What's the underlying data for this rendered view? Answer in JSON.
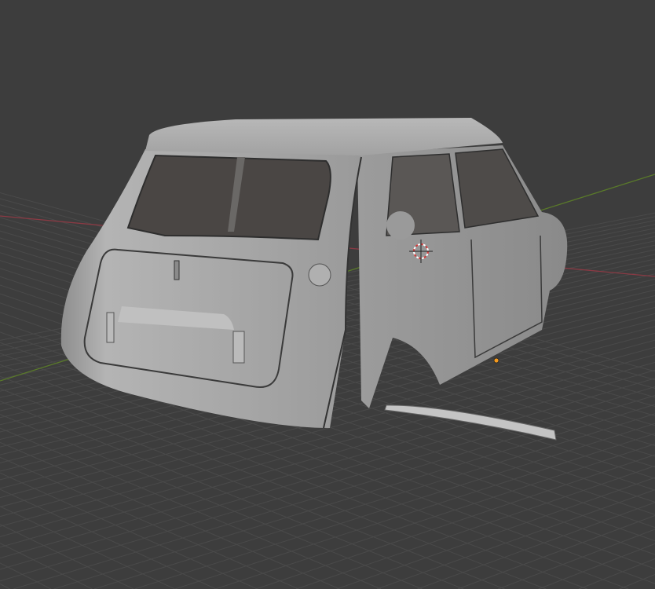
{
  "viewport": {
    "background_color": "#3d3d3d",
    "grid_color": "#4a4a4a",
    "x_axis_color": "#8a3a44",
    "y_axis_color": "#5a7a2a",
    "model_color": "#a9a9a9",
    "origin_color": "#f59a1d",
    "cursor_color": "#d43a3a"
  }
}
